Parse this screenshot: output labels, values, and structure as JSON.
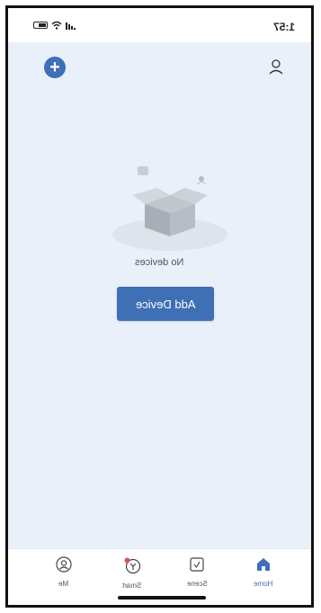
{
  "status_bar": {
    "time": "1:57"
  },
  "header": {
    "add_icon": "plus-circle-icon",
    "account_icon": "person-icon"
  },
  "empty_state": {
    "message": "No devices",
    "button_label": "Add Device"
  },
  "tabs": [
    {
      "label": "Me",
      "icon": "person-circle-icon"
    },
    {
      "label": "Smart",
      "icon": "smart-icon"
    },
    {
      "label": "Scene",
      "icon": "scene-icon"
    },
    {
      "label": "Home",
      "icon": "home-icon",
      "active": true
    }
  ],
  "colors": {
    "accent": "#3f6fb5",
    "background": "#eaf0f9",
    "active_tab": "#3f6fb5",
    "badge": "#d9534f"
  }
}
